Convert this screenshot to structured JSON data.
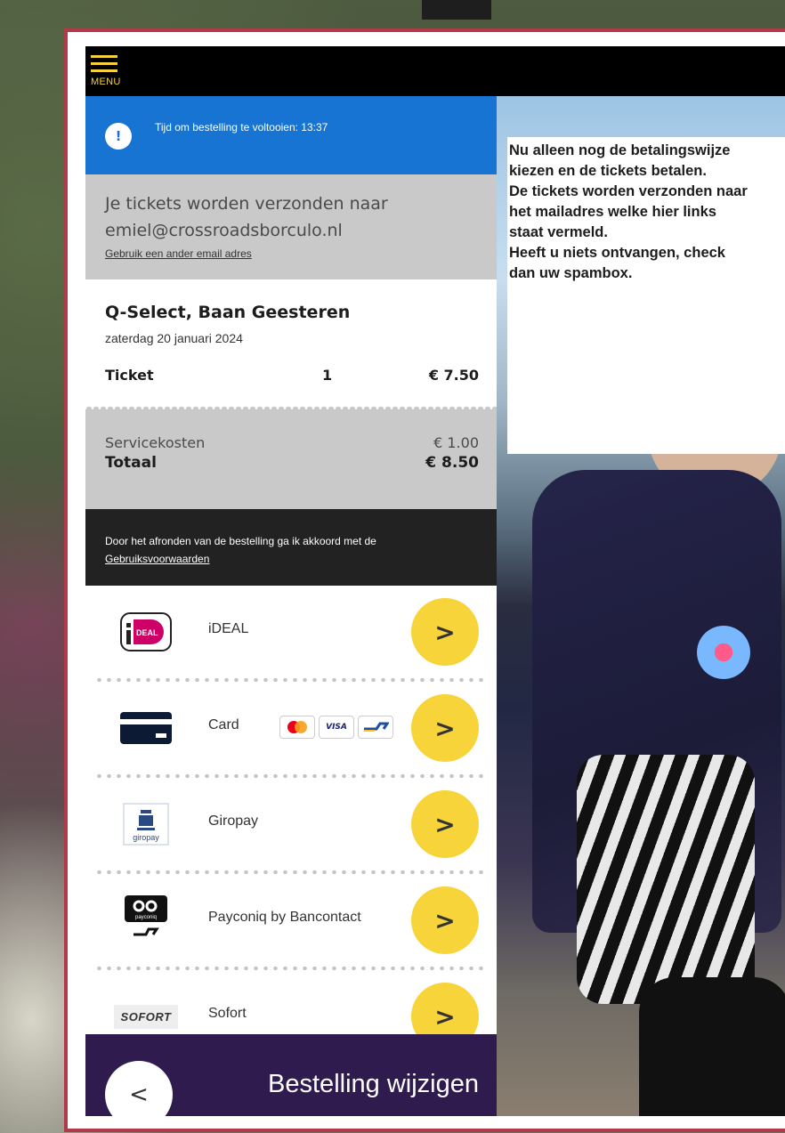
{
  "menu": {
    "label": "MENU"
  },
  "timer": {
    "text": "Tijd om bestelling te voltooien: 13:37",
    "icon": "alert-icon"
  },
  "email": {
    "line1": "Je tickets worden verzonden naar",
    "address": "emiel@crossroadsborculo.nl",
    "change_link": "Gebruik een ander email adres"
  },
  "event": {
    "name": "Q-Select, Baan Geesteren",
    "date": "zaterdag 20 januari 2024",
    "ticket_label": "Ticket",
    "ticket_qty": "1",
    "ticket_price": "€ 7.50"
  },
  "totals": {
    "service_label": "Servicekosten",
    "service_value": "€ 1.00",
    "total_label": "Totaal",
    "total_value": "€ 8.50"
  },
  "terms": {
    "text": "Door het afronden van de bestelling ga ik akkoord met de",
    "link": "Gebruiksvoorwaarden"
  },
  "payments": [
    {
      "label": "iDEAL",
      "icon": "ideal-logo-icon"
    },
    {
      "label": "Card",
      "icon": "credit-card-icon",
      "cards": [
        "mastercard-icon",
        "VISA",
        "bancontact-icon"
      ]
    },
    {
      "label": "Giropay",
      "icon": "giropay-logo-icon",
      "icon_text": "giropay"
    },
    {
      "label": "Payconiq by Bancontact",
      "icon": "payconiq-logo-icon",
      "icon_text": "payconiq"
    },
    {
      "label": "Sofort",
      "icon": "sofort-logo-icon",
      "icon_text": "SOFORT"
    }
  ],
  "go_glyph": ">",
  "bottom": {
    "back_glyph": "<",
    "label": "Bestelling wijzigen"
  },
  "note": {
    "lines": [
      "Nu alleen nog de betalingswijze",
      "kiezen en de tickets betalen.",
      "De tickets worden verzonden naar",
      "het mailadres welke hier links",
      "staat vermeld.",
      "Heeft u niets ontvangen, check",
      "dan uw spambox."
    ]
  },
  "colors": {
    "accent_yellow": "#f6d43a",
    "timer_blue": "#1874d2",
    "frame_red": "#b03a4a",
    "bottom_purple": "#2f1b4e"
  }
}
